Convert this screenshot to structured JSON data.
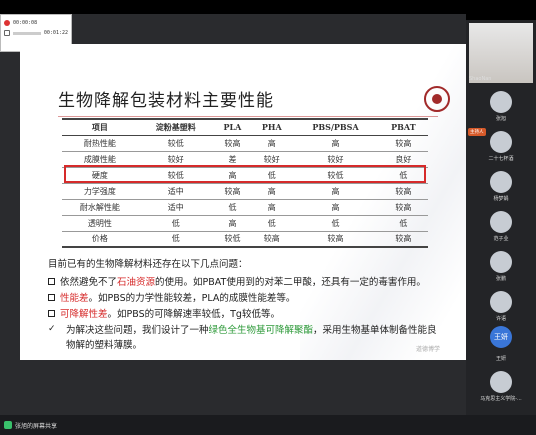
{
  "recorder": {
    "time_current": "00:00:08",
    "time_total": "00:01:22"
  },
  "slide": {
    "title": "生物降解包装材料主要性能",
    "table": {
      "headers": [
        "项目",
        "淀粉基塑料",
        "PLA",
        "PHA",
        "PBS/PBSA",
        "PBAT"
      ],
      "rows": [
        [
          "耐热性能",
          "较低",
          "较高",
          "高",
          "高",
          "较高"
        ],
        [
          "成膜性能",
          "较好",
          "差",
          "较好",
          "较好",
          "良好"
        ],
        [
          "硬度",
          "较低",
          "高",
          "低",
          "较低",
          "低"
        ],
        [
          "力学强度",
          "适中",
          "较高",
          "高",
          "高",
          "较高"
        ],
        [
          "耐水解性能",
          "适中",
          "低",
          "高",
          "高",
          "较高"
        ],
        [
          "透明性",
          "低",
          "高",
          "低",
          "低",
          "低"
        ],
        [
          "价格",
          "低",
          "较低",
          "较高",
          "较高",
          "较高"
        ]
      ]
    },
    "lead_text": "目前已有的生物降解材料还存在以下几点问题：",
    "bullets": [
      {
        "before": "依然避免不了",
        "emph": "石油资源",
        "after": "的使用。如PBAT使用到的对苯二甲酸，还具有一定的毒害作用。"
      },
      {
        "before": "",
        "emph": "性能差",
        "after": "。如PBS的力学性能较差，PLA的成膜性能差等。"
      },
      {
        "before": "",
        "emph": "可降解性差",
        "after": "。如PBS的可降解速率较低，Tg较低等。"
      }
    ],
    "check_item": {
      "before": "为解决这些问题，我们设计了一种",
      "emph": "绿色全生物基可降解聚酯",
      "after": "，采用生物基单体制备性能良"
    },
    "check_item_line2": "物解的塑料薄膜。",
    "footer_mark": "道德博学"
  },
  "participants": [
    {
      "name": "ShaoNan",
      "type": "video"
    },
    {
      "name": "张旭",
      "type": "avatar"
    },
    {
      "name": "二十七杯酒",
      "type": "avatar",
      "chip": "主持人"
    },
    {
      "name": "杨梦娟",
      "type": "avatar"
    },
    {
      "name": "范子业",
      "type": "avatar"
    },
    {
      "name": "张鹏",
      "type": "avatar"
    },
    {
      "name": "许语",
      "type": "avatar"
    },
    {
      "name": "王妍",
      "type": "text",
      "initials": "王妍"
    },
    {
      "name": "王妍",
      "type": "avatar"
    },
    {
      "name": "马克思主义学院-...",
      "type": "avatar"
    }
  ],
  "bottom": {
    "share_label": "张旭的屏幕共享"
  }
}
